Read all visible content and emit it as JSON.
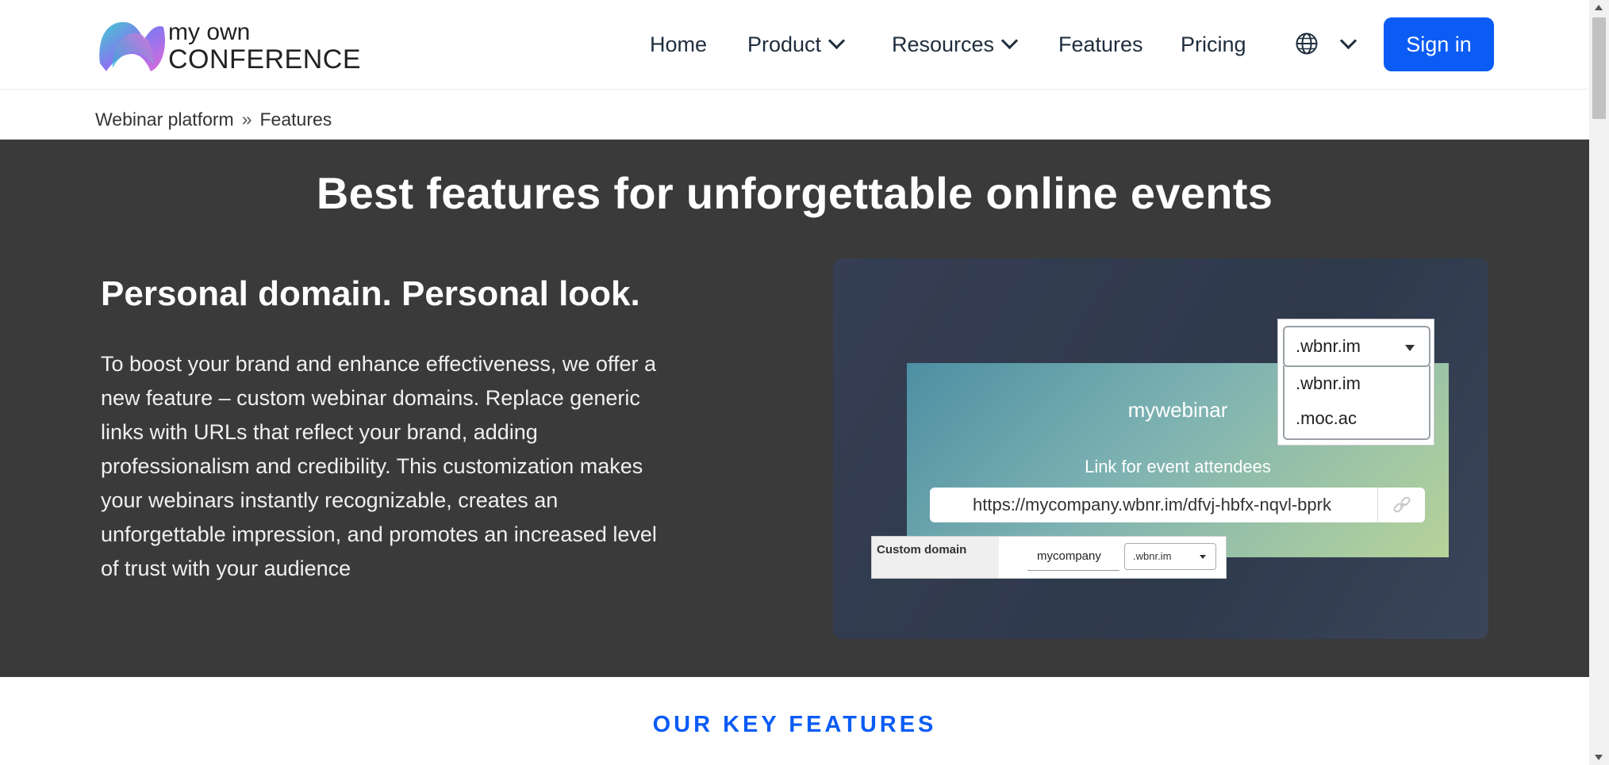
{
  "header": {
    "logo": {
      "line1": "my own",
      "line2": "CONFERENCE"
    },
    "nav": {
      "home": "Home",
      "product": "Product",
      "resources": "Resources",
      "features": "Features",
      "pricing": "Pricing"
    },
    "signin_label": "Sign in"
  },
  "breadcrumb": {
    "parent": "Webinar platform",
    "separator": "»",
    "current": "Features"
  },
  "hero": {
    "title": "Best features for unforgettable online events",
    "subtitle": "Personal domain. Personal look.",
    "description": "To boost your brand and enhance effectiveness, we offer a new feature – custom webinar domains. Replace generic links with URLs that reflect your brand, adding professionalism and credibility. This customization makes your webinars instantly recognizable, creates an unforgettable impression, and promotes an increased level of trust with your audience"
  },
  "illustration": {
    "banner_title": "mywebinar",
    "link_caption": "Link for event attendees",
    "url": "https://mycompany.wbnr.im/dfvj-hbfx-nqvl-bprk",
    "custom_domain": {
      "label": "Custom domain",
      "input_value": "mycompany",
      "select_value": ".wbnr.im"
    },
    "dropdown": {
      "selected": ".wbnr.im",
      "options": [
        ".wbnr.im",
        ".moc.ac"
      ]
    }
  },
  "sections": {
    "key_features": "OUR KEY FEATURES"
  },
  "colors": {
    "accent": "#0b5cf5",
    "hero_bg": "#3a3a3a"
  }
}
